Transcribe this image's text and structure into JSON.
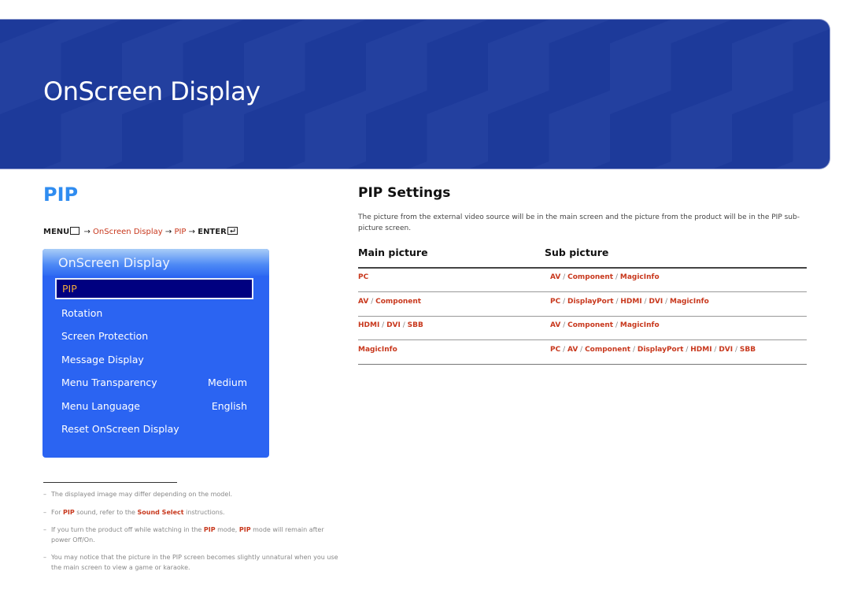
{
  "banner": {
    "title": "OnScreen Display"
  },
  "section": {
    "title": "PIP"
  },
  "breadcrumb": {
    "menu": "MENU",
    "menu_icon": "menu-icon",
    "arrow": "→",
    "path": [
      "OnScreen Display",
      "PIP"
    ],
    "enter": "ENTER",
    "enter_icon": "enter-icon"
  },
  "osd": {
    "header": "OnScreen Display",
    "selected": "PIP",
    "items": [
      {
        "label": "Rotation",
        "value": ""
      },
      {
        "label": "Screen Protection",
        "value": ""
      },
      {
        "label": "Message Display",
        "value": ""
      },
      {
        "label": "Menu Transparency",
        "value": "Medium"
      },
      {
        "label": "Menu Language",
        "value": "English"
      },
      {
        "label": "Reset OnScreen Display",
        "value": ""
      }
    ]
  },
  "notes": {
    "dash": "–",
    "n1": "The displayed image may differ depending on the model.",
    "n2a": "For ",
    "n2b": "PIP",
    "n2c": " sound, refer to the ",
    "n2d": "Sound Select",
    "n2e": " instructions.",
    "n3a": "If you turn the product off while watching in the ",
    "n3b": "PIP",
    "n3c": " mode, ",
    "n3d": "PIP",
    "n3e": " mode will remain after power Off/On.",
    "n4": "You may notice that the picture in the PIP screen becomes slightly unnatural when you use the main screen to view a game or karaoke."
  },
  "pip_settings": {
    "title": "PIP Settings",
    "description": "The picture from the external video source will be in the main screen and the picture from the product will be in the PIP sub-picture screen.",
    "col_main": "Main picture",
    "col_sub": "Sub picture",
    "rows": [
      {
        "main": [
          "PC"
        ],
        "sub": [
          "AV",
          "Component",
          "MagicInfo"
        ]
      },
      {
        "main": [
          "AV",
          "Component"
        ],
        "sub": [
          "PC",
          "DisplayPort",
          "HDMI",
          "DVI",
          "MagicInfo"
        ]
      },
      {
        "main": [
          "HDMI",
          "DVI",
          "SBB"
        ],
        "sub": [
          "AV",
          "Component",
          "MagicInfo"
        ]
      },
      {
        "main": [
          "MagicInfo"
        ],
        "sub": [
          "PC",
          "AV",
          "Component",
          "DisplayPort",
          "HDMI",
          "DVI",
          "SBB"
        ]
      }
    ]
  },
  "colors": {
    "banner": "#1d3a9a",
    "section_title": "#2f8cf0",
    "highlight": "#c8381d",
    "osd_bg": "#2b64f2",
    "osd_selected_bg": "#000080",
    "osd_selected_text": "#f2a93b"
  }
}
